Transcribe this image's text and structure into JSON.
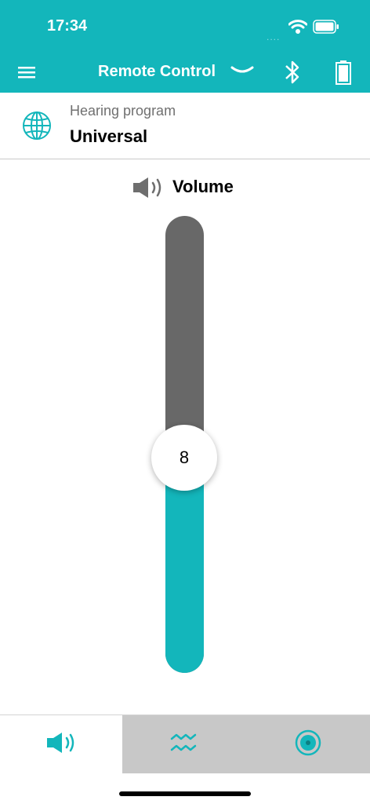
{
  "status_bar": {
    "time": "17:34",
    "signal": "....",
    "wifi_icon": "wifi-icon",
    "battery_icon": "status-battery-icon"
  },
  "app_bar": {
    "title": "Remote Control",
    "menu_icon": "menu-icon",
    "chevron_icon": "chevron-down-icon",
    "bluetooth_icon": "bluetooth-icon",
    "battery_icon": "battery-icon"
  },
  "program": {
    "label": "Hearing program",
    "value": "Universal",
    "icon": "globe-icon"
  },
  "volume": {
    "title": "Volume",
    "value": "8",
    "level": 0.47,
    "icon": "speaker-icon"
  },
  "tabs": [
    {
      "icon": "speaker-icon",
      "selected": true
    },
    {
      "icon": "waves-icon",
      "selected": false
    },
    {
      "icon": "target-icon",
      "selected": false
    }
  ],
  "colors": {
    "accent": "#13b6bb",
    "track": "#686868",
    "tab_inactive": "#c8c8c8"
  }
}
